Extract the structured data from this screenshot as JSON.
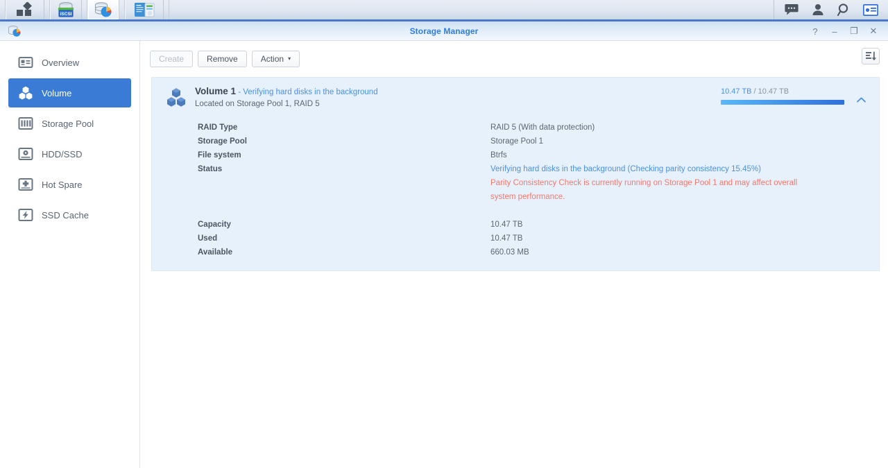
{
  "taskbar": {
    "apps": [
      {
        "name": "main-menu-icon",
        "label": "Main Menu"
      },
      {
        "name": "iscsi-manager-icon",
        "label": "iSCSI Manager"
      },
      {
        "name": "storage-manager-icon",
        "label": "Storage Manager"
      },
      {
        "name": "package-center-icon",
        "label": "Package Center"
      }
    ],
    "tray": [
      {
        "name": "notifications-icon",
        "label": "Notifications"
      },
      {
        "name": "user-account-icon",
        "label": "Account"
      },
      {
        "name": "search-icon",
        "label": "Search"
      },
      {
        "name": "widgets-icon",
        "label": "Widgets"
      }
    ]
  },
  "window": {
    "title": "Storage Manager",
    "icon": "storage-manager-icon",
    "controls": [
      {
        "name": "help-button",
        "glyph": "?"
      },
      {
        "name": "minimize-button",
        "glyph": "–"
      },
      {
        "name": "maximize-button",
        "glyph": "❐"
      },
      {
        "name": "close-button",
        "glyph": "✕"
      }
    ]
  },
  "sidebar": {
    "items": [
      {
        "label": "Overview",
        "icon": "overview-icon",
        "selected": false
      },
      {
        "label": "Volume",
        "icon": "volume-icon",
        "selected": true
      },
      {
        "label": "Storage Pool",
        "icon": "storage-pool-icon",
        "selected": false
      },
      {
        "label": "HDD/SSD",
        "icon": "hdd-ssd-icon",
        "selected": false
      },
      {
        "label": "Hot Spare",
        "icon": "hot-spare-icon",
        "selected": false
      },
      {
        "label": "SSD Cache",
        "icon": "ssd-cache-icon",
        "selected": false
      }
    ]
  },
  "toolbar": {
    "create_label": "Create",
    "create_disabled": true,
    "remove_label": "Remove",
    "action_label": "Action",
    "action_caret": "▾",
    "sort_icon": "sort-order-icon"
  },
  "volume": {
    "icon": "volume-cubes-icon",
    "title": "Volume 1",
    "title_separator": " - ",
    "status_short": "Verifying hard disks in the background",
    "subtitle": "Located on Storage Pool 1, RAID 5",
    "capacity_used_text": "10.47 TB",
    "capacity_total_text": " / 10.47 TB",
    "capacity_percent": 100,
    "collapse_icon": "chevron-up-icon",
    "details": [
      {
        "key": "RAID Type",
        "value": "RAID 5 (With data protection)",
        "style": "normal"
      },
      {
        "key": "Storage Pool",
        "value": "Storage Pool 1",
        "style": "normal"
      },
      {
        "key": "File system",
        "value": "Btrfs",
        "style": "normal"
      },
      {
        "key": "Status",
        "value": "Verifying hard disks in the background (Checking parity consistency 15.45%)",
        "style": "blue"
      },
      {
        "key": "",
        "value": "Parity Consistency Check is currently running on Storage Pool 1 and may affect overall system performance.",
        "style": "red"
      },
      {
        "key": "Capacity",
        "value": "10.47 TB",
        "style": "normal"
      },
      {
        "key": "Used",
        "value": "10.47 TB",
        "style": "normal"
      },
      {
        "key": "Available",
        "value": "660.03 MB",
        "style": "normal"
      }
    ]
  },
  "colors": {
    "accent_blue": "#3a7bd5",
    "title_blue": "#2f7ce0",
    "status_blue": "#4a90e2",
    "warning_red": "#f4776b",
    "panel_bg": "#e7f1fc"
  }
}
